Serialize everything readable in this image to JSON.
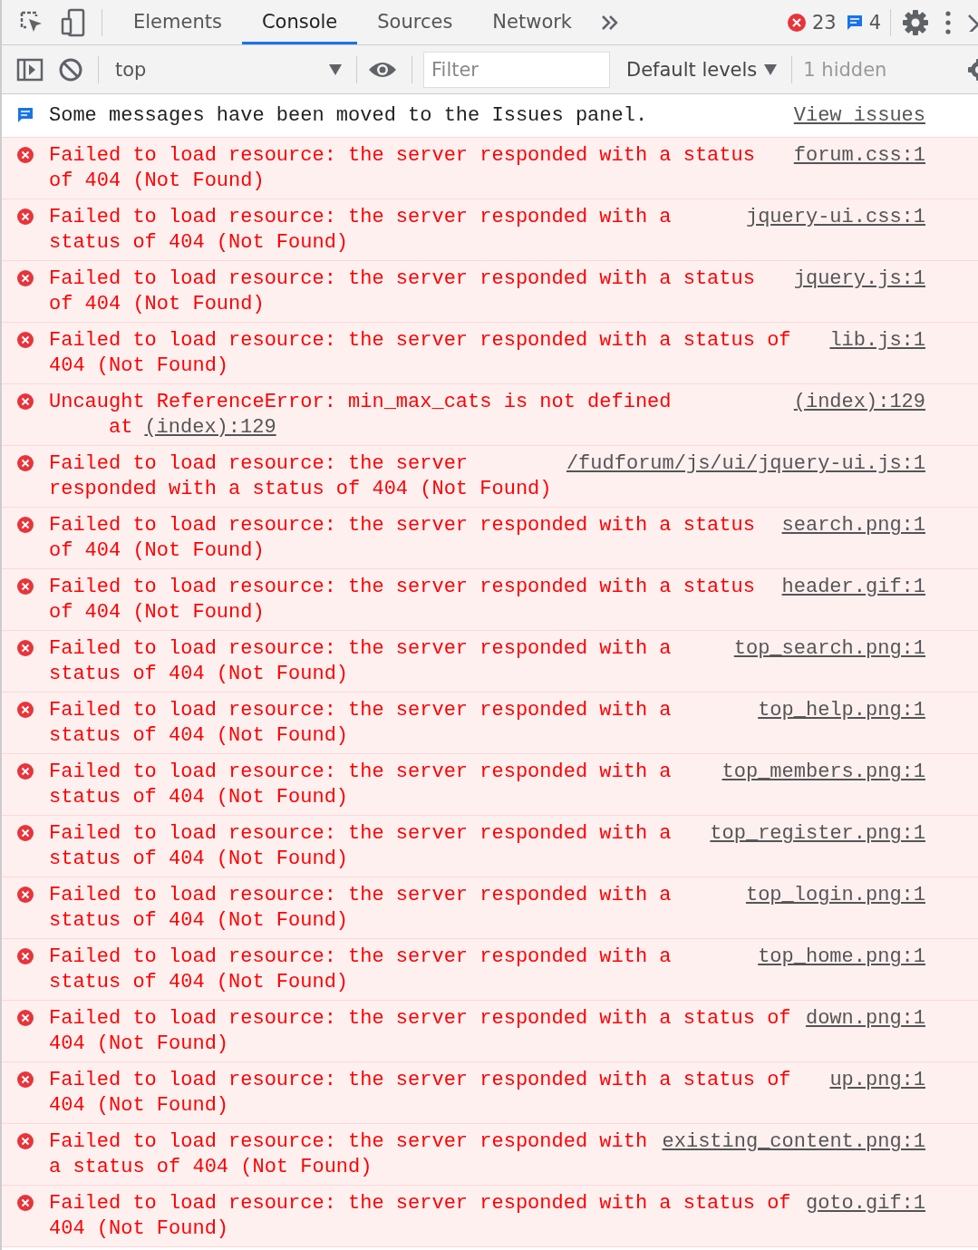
{
  "tabs": [
    {
      "label": "Elements",
      "selected": false
    },
    {
      "label": "Console",
      "selected": true
    },
    {
      "label": "Sources",
      "selected": false
    },
    {
      "label": "Network",
      "selected": false
    }
  ],
  "counts": {
    "errors": "23",
    "messages": "4"
  },
  "toolbar": {
    "context": "top",
    "filter": {
      "placeholder": "Filter"
    },
    "levels": "Default levels",
    "hidden": "1 hidden"
  },
  "notice": {
    "text": "Some messages have been moved to the Issues panel.",
    "link": "View issues"
  },
  "messages": [
    {
      "kind": "error",
      "text": "Failed to load resource: the server responded with a status of 404 (Not Found)",
      "source": "forum.css:1"
    },
    {
      "kind": "error",
      "text": "Failed to load resource: the server responded with a status of 404 (Not Found)",
      "source": "jquery-ui.css:1"
    },
    {
      "kind": "error",
      "text": "Failed to load resource: the server responded with a status of 404 (Not Found)",
      "source": "jquery.js:1"
    },
    {
      "kind": "error",
      "text": "Failed to load resource: the server responded with a status of 404 (Not Found)",
      "source": "lib.js:1"
    },
    {
      "kind": "error",
      "text": "Uncaught ReferenceError: min_max_cats is not defined",
      "source": "(index):129",
      "stack": {
        "prefix": "at",
        "link": "(index):129"
      }
    },
    {
      "kind": "error",
      "text": "Failed to load resource: the server responded with a status of 404 (Not Found)",
      "source": "/fudforum/js/ui/jquery-ui.js:1"
    },
    {
      "kind": "error",
      "text": "Failed to load resource: the server responded with a status of 404 (Not Found)",
      "source": "search.png:1"
    },
    {
      "kind": "error",
      "text": "Failed to load resource: the server responded with a status of 404 (Not Found)",
      "source": "header.gif:1"
    },
    {
      "kind": "error",
      "text": "Failed to load resource: the server responded with a status of 404 (Not Found)",
      "source": "top_search.png:1"
    },
    {
      "kind": "error",
      "text": "Failed to load resource: the server responded with a status of 404 (Not Found)",
      "source": "top_help.png:1"
    },
    {
      "kind": "error",
      "text": "Failed to load resource: the server responded with a status of 404 (Not Found)",
      "source": "top_members.png:1"
    },
    {
      "kind": "error",
      "text": "Failed to load resource: the server responded with a status of 404 (Not Found)",
      "source": "top_register.png:1"
    },
    {
      "kind": "error",
      "text": "Failed to load resource: the server responded with a status of 404 (Not Found)",
      "source": "top_login.png:1"
    },
    {
      "kind": "error",
      "text": "Failed to load resource: the server responded with a status of 404 (Not Found)",
      "source": "top_home.png:1"
    },
    {
      "kind": "error",
      "text": "Failed to load resource: the server responded with a status of 404 (Not Found)",
      "source": "down.png:1"
    },
    {
      "kind": "error",
      "text": "Failed to load resource: the server responded with a status of 404 (Not Found)",
      "source": "up.png:1"
    },
    {
      "kind": "error",
      "text": "Failed to load resource: the server responded with a status of 404 (Not Found)",
      "source": "existing_content.png:1"
    },
    {
      "kind": "error",
      "text": "Failed to load resource: the server responded with a status of 404 (Not Found)",
      "source": "goto.gif:1"
    }
  ]
}
